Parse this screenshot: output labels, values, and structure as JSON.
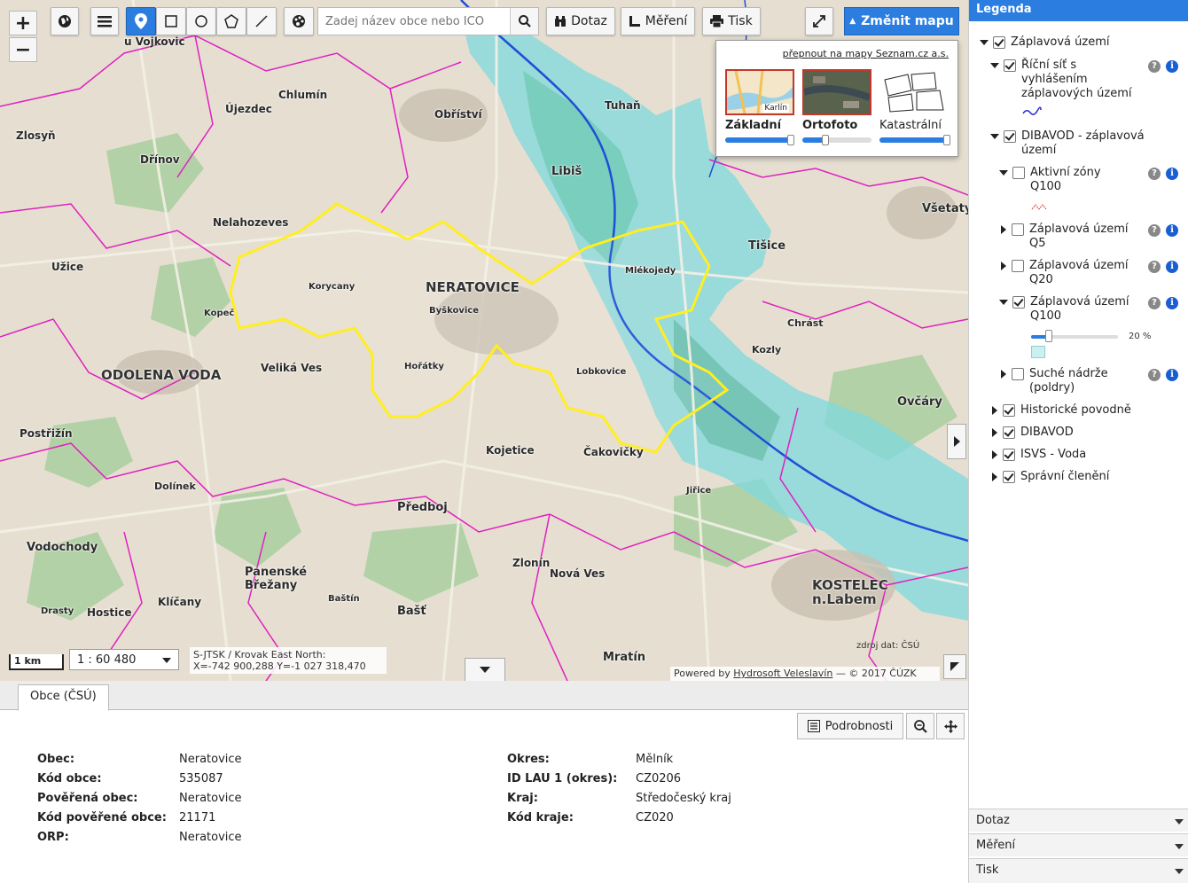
{
  "toolbar": {
    "search_placeholder": "Zadej název obce nebo IČO",
    "query_label": "Dotaz",
    "measure_label": "Měření",
    "print_label": "Tisk",
    "change_map_label": "Změnit mapu"
  },
  "basemaps": {
    "switch_link": "přepnout na mapy Seznam.cz a.s.",
    "items": [
      {
        "name": "Základní",
        "thumb_text": "Karlín"
      },
      {
        "name": "Ortofoto"
      },
      {
        "name": "Katastrální"
      }
    ]
  },
  "map": {
    "scale_bar": "1 km",
    "scale": "1 : 60 480",
    "crs": "S-JTSK / Krovak East North:",
    "coords": "X=-742 900,288 Y=-1 027 318,470",
    "attribution_prefix": "Powered by ",
    "attribution_link": "Hydrosoft Veleslavín",
    "attribution_suffix": " — © 2017 ČÚZK",
    "source": "zdroj dat: ČSÚ",
    "places": [
      "u Vojkovic",
      "Chlumín",
      "Újezdec",
      "Obříství",
      "Tuhaň",
      "Zlosyň",
      "Dřínov",
      "Libiš",
      "Všetaty",
      "Nelahozeves",
      "Tišice",
      "Užice",
      "Korycany",
      "NERATOVICE",
      "Byškovice",
      "Mlékojedy",
      "Kopeč",
      "Chrást",
      "ODOLENA VODA",
      "Veliká Ves",
      "Hořátky",
      "Lobkovice",
      "Kozly",
      "Ovčáry",
      "Postřižín",
      "Kojetice",
      "Čakovičky",
      "Dolínek",
      "Předboj",
      "Jiřice",
      "Vodochody",
      "Panenské Břežany",
      "Zlonín",
      "Nová Ves",
      "KOSTELEC n.Labem",
      "Klíčany",
      "Hostice",
      "Baštín",
      "Bašť",
      "Mratín",
      "Drasty"
    ]
  },
  "legend": {
    "title": "Legenda",
    "items": [
      {
        "label": "Záplavová území",
        "checked": true
      },
      {
        "label": "Říční síť s vyhlášením záplavových území",
        "checked": true
      },
      {
        "label": "DIBAVOD - záplavová území",
        "checked": true
      },
      {
        "label": "Aktivní zóny Q100",
        "checked": false
      },
      {
        "label": "Záplavová území Q5",
        "checked": false
      },
      {
        "label": "Záplavová území Q20",
        "checked": false
      },
      {
        "label": "Záplavová území Q100",
        "checked": true
      },
      {
        "label": "Suché nádrže (poldry)",
        "checked": false
      },
      {
        "label": "Historické povodně",
        "checked": true
      },
      {
        "label": "DIBAVOD",
        "checked": true
      },
      {
        "label": "ISVS - Voda",
        "checked": true
      },
      {
        "label": "Správní členění",
        "checked": true
      }
    ],
    "opacity": "20 %",
    "accordions": [
      "Dotaz",
      "Měření",
      "Tisk"
    ]
  },
  "detail": {
    "tab": "Obce (ČSÚ)",
    "details_button": "Podrobnosti",
    "left": [
      {
        "key": "Obec:",
        "value": "Neratovice"
      },
      {
        "key": "Kód obce:",
        "value": "535087"
      },
      {
        "key": "Pověřená obec:",
        "value": "Neratovice"
      },
      {
        "key": "Kód pověřené obce:",
        "value": "21171"
      },
      {
        "key": "ORP:",
        "value": "Neratovice"
      }
    ],
    "right": [
      {
        "key": "Okres:",
        "value": "Mělník"
      },
      {
        "key": "ID LAU 1 (okres):",
        "value": "CZ0206"
      },
      {
        "key": "Kraj:",
        "value": "Středočeský kraj"
      },
      {
        "key": "Kód kraje:",
        "value": "CZ020"
      }
    ]
  },
  "colors": {
    "accent": "#2b7de0",
    "boundary": "#e020c0",
    "selection": "#ffee22",
    "flood": "#7fd8dc",
    "forest": "#8fc7a0"
  }
}
